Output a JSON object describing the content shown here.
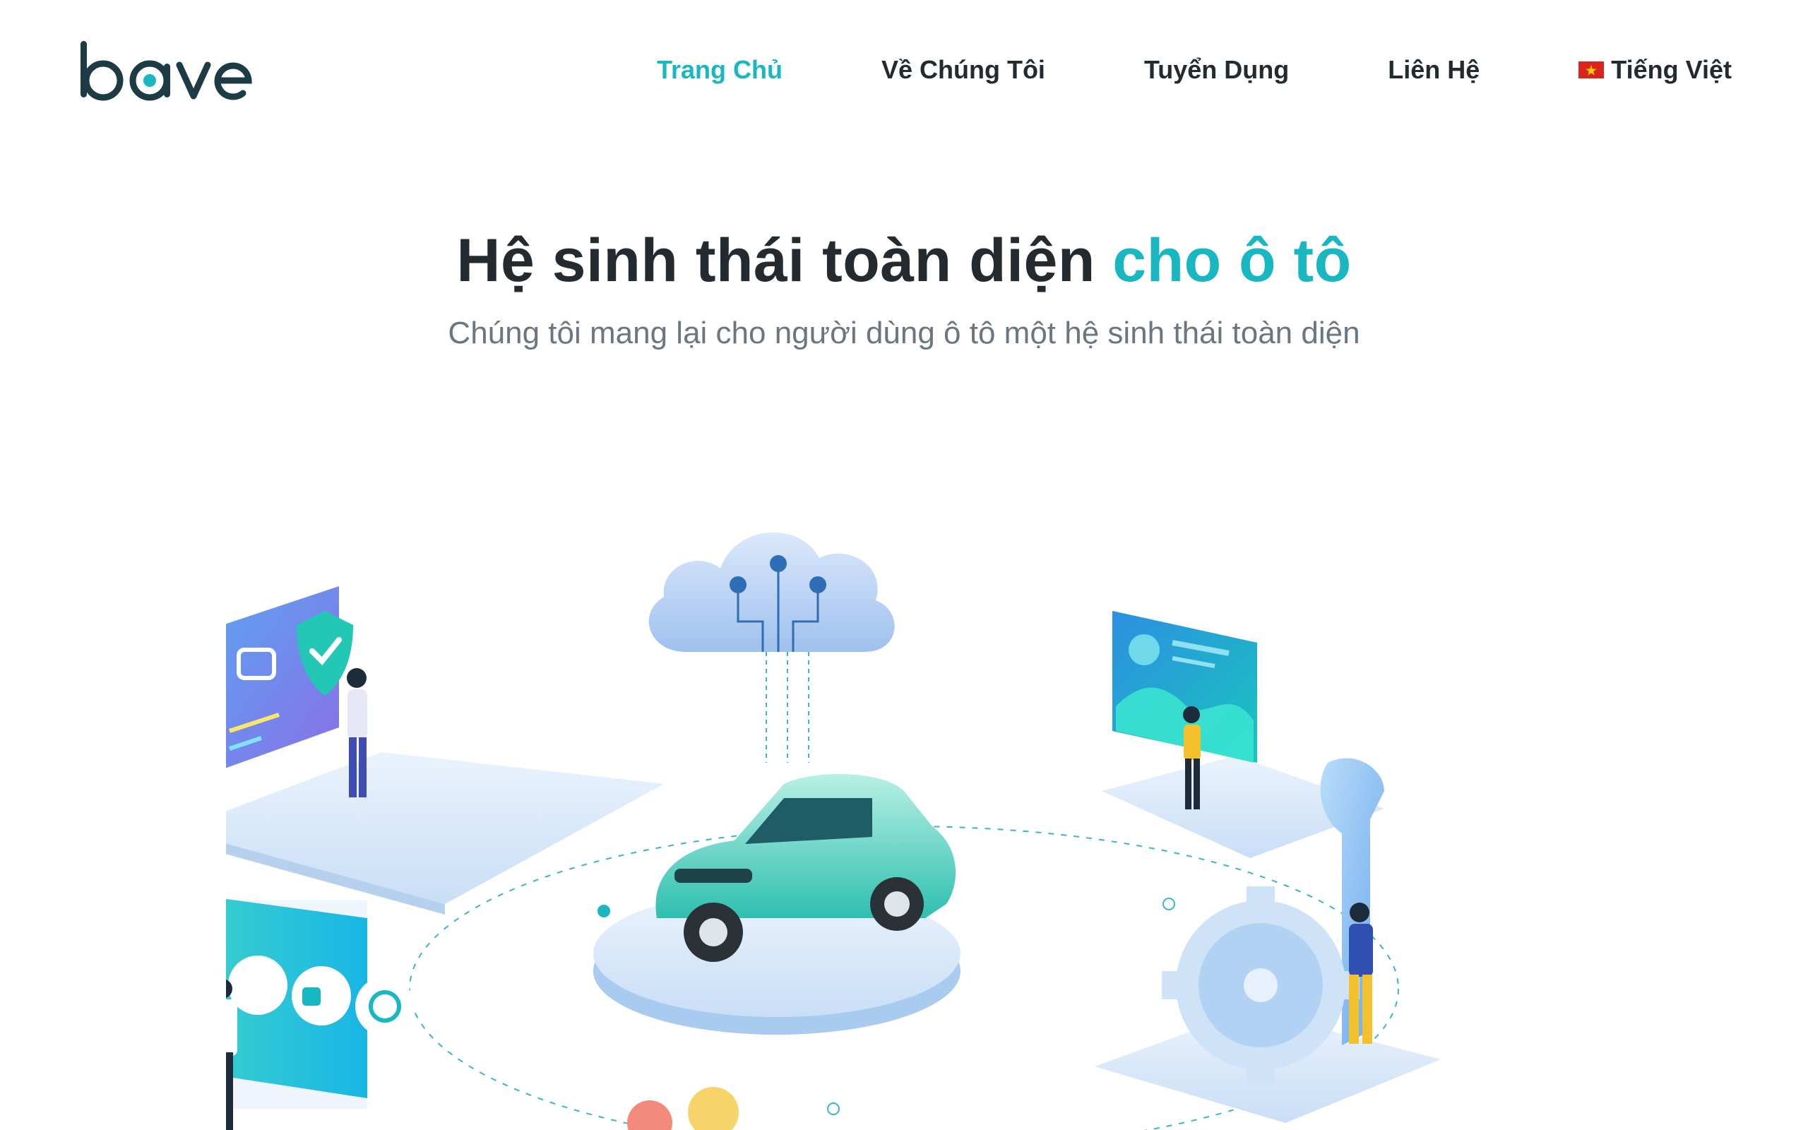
{
  "header": {
    "logo_text": "bave",
    "nav": [
      {
        "label": "Trang Chủ",
        "active": true
      },
      {
        "label": "Về Chúng Tôi",
        "active": false
      },
      {
        "label": "Tuyển Dụng",
        "active": false
      },
      {
        "label": "Liên Hệ",
        "active": false
      }
    ],
    "language": {
      "label": "Tiếng Việt",
      "flag_icon": "vietnam-flag-icon"
    }
  },
  "hero": {
    "title_main": "Hệ sinh thái toàn diện",
    "title_accent": "cho ô tô",
    "subtitle": "Chúng tôi mang lại cho người dùng ô tô một hệ sinh thái toàn diện"
  },
  "colors": {
    "accent": "#19b7c2",
    "text_dark": "#232a30",
    "text_muted": "#6b7780",
    "logo": "#1d3b44"
  },
  "illustration": {
    "icons": [
      "cloud-icon",
      "shield-check-icon",
      "car-icon",
      "chart-screen-icon",
      "gear-icon",
      "wrench-icon",
      "service-icons-panel"
    ]
  }
}
